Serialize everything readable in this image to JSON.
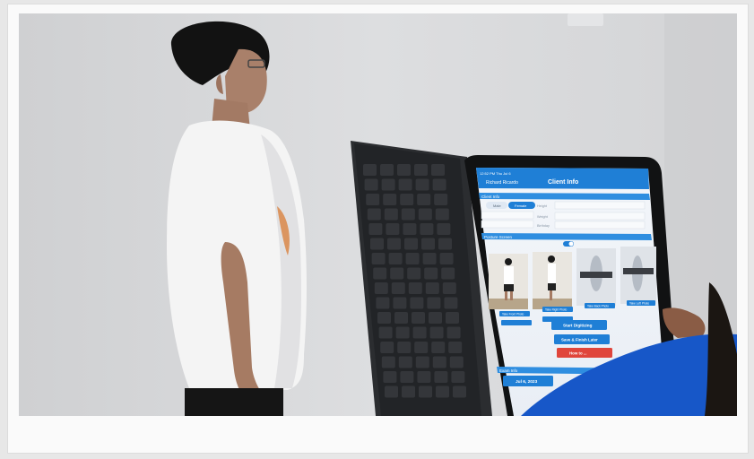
{
  "photo": {
    "tablet": {
      "status_time": "12:52 PM  Thu Jul 6",
      "back_label": "Richard Ricardo",
      "title": "Client Info",
      "section_client": "Client Info",
      "sex_male": "Male",
      "sex_female": "Female",
      "field_height": "Height",
      "field_weight": "Weight",
      "field_birthday": "Birthday",
      "section_photos": "Posture Screen",
      "btn_front": "Take Front Photo",
      "btn_side": "Take Right Photo",
      "btn_back": "Take Back Photo",
      "btn_left": "Take Left Photo",
      "btn_start": "Start Digitizing",
      "btn_save": "Save & Finish Later",
      "btn_red": "How to ...",
      "section_exam": "Exam Info",
      "exam_date": "Jul 6, 2023"
    },
    "colors": {
      "wall": "#d9dadc",
      "shirt": "#f4f4f4",
      "app_blue": "#1f7fd6",
      "keyboard": "#2b2d30",
      "sleeve": "#1757c8"
    }
  }
}
